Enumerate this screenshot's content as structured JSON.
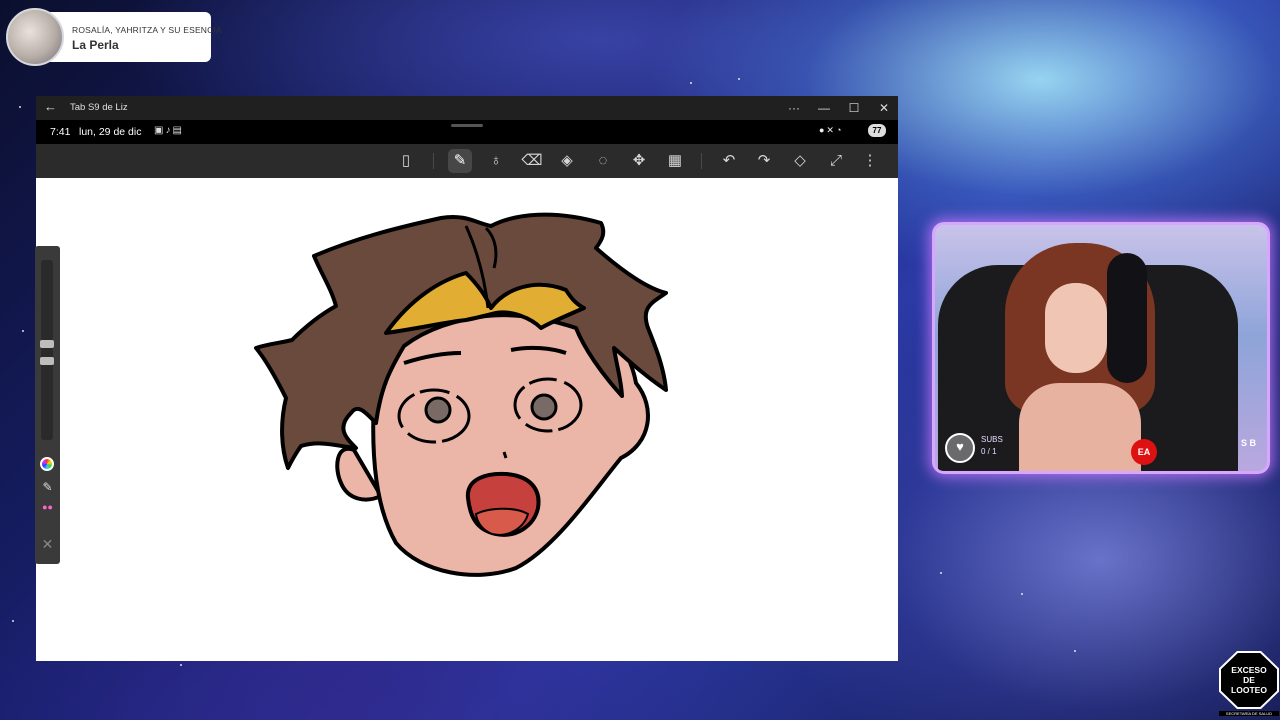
{
  "music": {
    "artist": "ROSALÍA, YAHRITZA Y SU ESENCIA",
    "song": "La Perla"
  },
  "window": {
    "title": "Tab S9 de Liz",
    "controls": [
      "···",
      "—",
      "☐",
      "✕"
    ]
  },
  "statusbar": {
    "time": "7:41",
    "date": "lun, 29 de dic",
    "battery": "77"
  },
  "toolbar": {
    "tools": [
      {
        "name": "clipboard",
        "icon": "clipboard-icon",
        "glyph": "▯"
      },
      {
        "name": "pen",
        "icon": "pen-icon",
        "glyph": "✎",
        "active": true
      },
      {
        "name": "smudge",
        "icon": "smudge-icon",
        "glyph": "♁"
      },
      {
        "name": "eraser",
        "icon": "eraser-icon",
        "glyph": "⌫"
      },
      {
        "name": "fill",
        "icon": "paint-bucket-icon",
        "glyph": "◈"
      },
      {
        "name": "lasso",
        "icon": "lasso-icon",
        "glyph": "◌"
      },
      {
        "name": "transform",
        "icon": "transform-icon",
        "glyph": "✥"
      },
      {
        "name": "grid",
        "icon": "grid-icon",
        "glyph": "▦"
      },
      {
        "name": "undo",
        "icon": "undo-icon",
        "glyph": "↶"
      },
      {
        "name": "redo",
        "icon": "redo-icon",
        "glyph": "↷"
      },
      {
        "name": "layers",
        "icon": "layers-icon",
        "glyph": "◇"
      },
      {
        "name": "fullscreen",
        "icon": "expand-icon",
        "glyph": "⤢"
      },
      {
        "name": "more",
        "icon": "more-vertical-icon",
        "glyph": "⋮"
      }
    ]
  },
  "webcam": {
    "subs_label": "SUBS",
    "subs_count": "0 / 1",
    "ea_label": "EA",
    "sb_label": "S B"
  },
  "badge": {
    "line1": "EXCESO",
    "line2": "DE",
    "line3": "LOOTEO",
    "sub": "SECRETARÍA DE SALUD"
  },
  "colors": {
    "hair_brown": "#6b4a3e",
    "hair_blonde": "#e1ae33",
    "skin": "#ebb6a8",
    "mouth": "#c6403d",
    "webcam_glow": "#d7a6ff"
  }
}
